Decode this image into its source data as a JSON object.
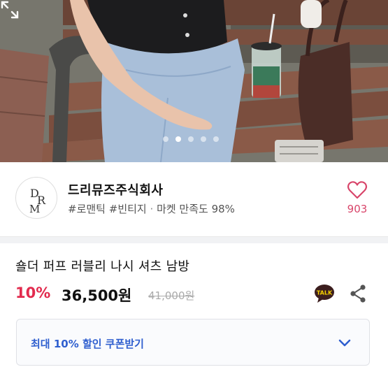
{
  "product_image": {
    "pager_count": 5,
    "pager_active_index": 1,
    "icons": {
      "expand": "expand-icon"
    }
  },
  "store": {
    "logo_letters": "DRM",
    "name": "드리뮤즈주식회사",
    "tags": [
      "#로맨틱",
      "#빈티지"
    ],
    "separator": "·",
    "satisfaction": "마켓 만족도 98%",
    "like_count": "903",
    "icons": {
      "like": "heart-outline-icon"
    }
  },
  "product": {
    "title": "숄더 퍼프 러블리 나시 셔츠 남방",
    "discount": "10%",
    "price": "36,500원",
    "original_price": "41,000원",
    "icons": {
      "talk": "kakaotalk-icon",
      "share": "share-icon"
    },
    "talk_badge_text": "TALK"
  },
  "coupon": {
    "label": "최대 10% 할인 쿠폰받기",
    "icon": "chevron-down-icon"
  },
  "colors": {
    "discount": "#e22b4e",
    "like": "#d8456a",
    "coupon_text": "#2f5fcf",
    "talk_bubble": "#3c1e1e"
  }
}
